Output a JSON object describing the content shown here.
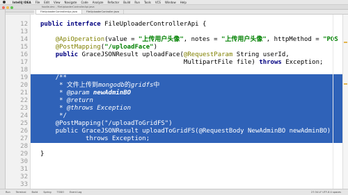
{
  "menubar": {
    "app": "IntelliJ IDEA",
    "items": [
      "File",
      "Edit",
      "View",
      "Navigate",
      "Code",
      "Analyze",
      "Refactor",
      "Build",
      "Run",
      "Tools",
      "VCS",
      "Window",
      "Help"
    ]
  },
  "titlebar": {
    "path": "foodie-dev – FileUploaderControllerApi.java"
  },
  "tabs": [
    {
      "label": "FileUploaderControllerApi.java",
      "active": true
    },
    {
      "label": "FileUploaderController.java",
      "active": false
    }
  ],
  "editor": {
    "lines": [
      {
        "n": "12",
        "html": "<span class=\"kw\">public interface</span> FileUploaderControllerApi {"
      },
      {
        "n": "13",
        "html": ""
      },
      {
        "n": "14",
        "html": "    <span class=\"ann\">@ApiOperation</span>(value = <span class=\"str\">\"上传用户头像\"</span>, notes = <span class=\"str\">\"上传用户头像\"</span>, httpMethod = <span class=\"str\">\"POS</span>"
      },
      {
        "n": "15",
        "html": "    <span class=\"ann\">@PostMapping</span>(<span class=\"str\">\"/uploadFace\"</span>)"
      },
      {
        "n": "16",
        "html": "    <span class=\"kw\">public</span> GraceJSONResult uploadFace(<span class=\"ann\">@RequestParam</span> String userId,"
      },
      {
        "n": "17",
        "html": "                                      MultipartFile file) <span class=\"kw\">throws</span> Exception;"
      },
      {
        "n": "18",
        "html": ""
      },
      {
        "n": "19",
        "html": "    /**",
        "selected": true
      },
      {
        "n": "20",
        "html": "     * 文件上传到<span class=\"italic\">mongodb</span>的<span class=\"italic\">gridfs</span>中",
        "selected": true
      },
      {
        "n": "21",
        "html": "     * <span class=\"italic\">@param</span> <span class=\"bolditalic\">newAdminBO</span>",
        "selected": true
      },
      {
        "n": "22",
        "html": "     * <span class=\"italic\">@return</span>",
        "selected": true
      },
      {
        "n": "23",
        "html": "     * <span class=\"italic\">@throws</span> <span class=\"italic\">Exception</span>",
        "selected": true
      },
      {
        "n": "24",
        "html": "     */",
        "selected": true
      },
      {
        "n": "25",
        "html": "    @PostMapping(\"/uploadToGridFS\")",
        "selected": true
      },
      {
        "n": "26",
        "html": "    public GraceJSONResult uploadToGridFS(@RequestBody NewAdminBO newAdminBO)",
        "selected": true
      },
      {
        "n": "27",
        "html": "            throws Exception;",
        "selected": true
      },
      {
        "n": "28",
        "html": ""
      },
      {
        "n": "29",
        "html": "}"
      },
      {
        "n": "30",
        "html": ""
      },
      {
        "n": "31",
        "html": ""
      },
      {
        "n": "32",
        "html": ""
      },
      {
        "n": "33",
        "html": ""
      }
    ]
  },
  "statusbar": {
    "items": [
      "Run",
      "Terminal",
      "Build",
      "Spring",
      "TODO",
      "Event Log"
    ],
    "position": "27:34  LF  UTF-8  4 spaces"
  },
  "colors": {
    "selection": "#2f62b8",
    "keyword": "#000080",
    "annotation": "#808000",
    "string": "#008000"
  }
}
